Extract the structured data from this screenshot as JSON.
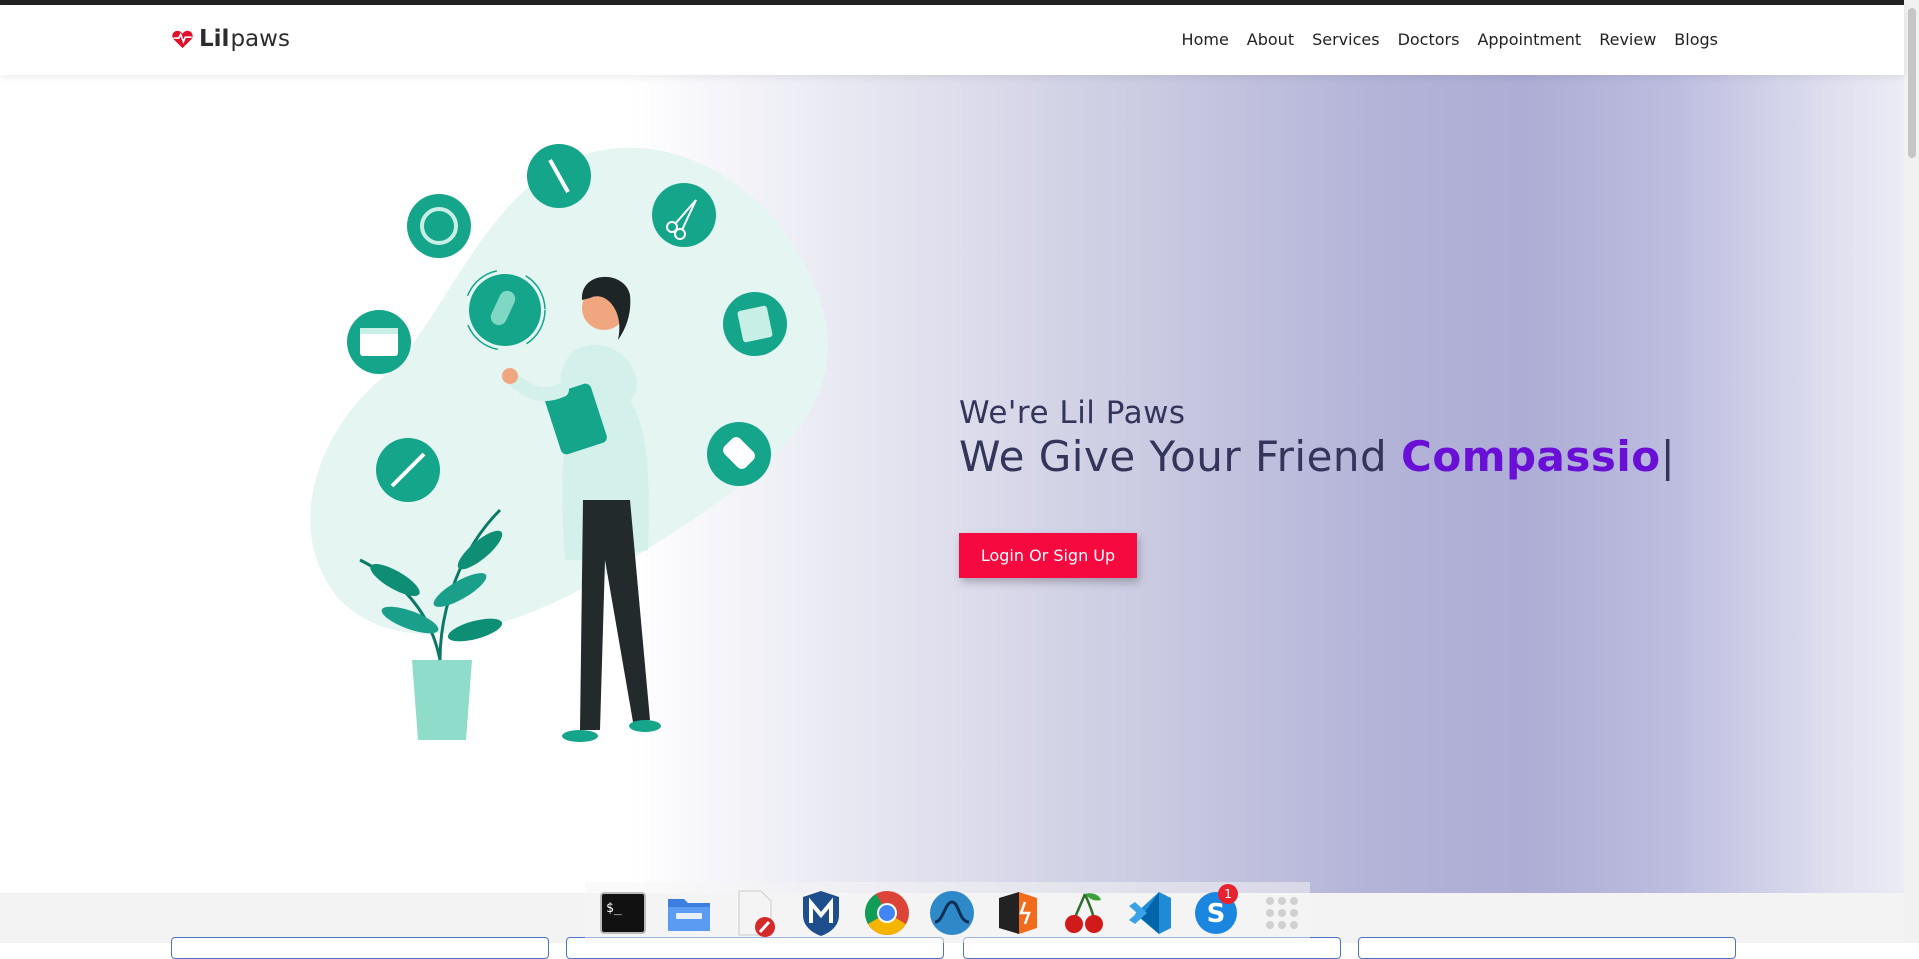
{
  "brand": {
    "bold": "Lil",
    "rest": "paws",
    "accent": "#e0112b"
  },
  "nav": {
    "items": [
      {
        "id": "home",
        "label": "Home"
      },
      {
        "id": "about",
        "label": "About"
      },
      {
        "id": "services",
        "label": "Services"
      },
      {
        "id": "doctors",
        "label": "Doctors"
      },
      {
        "id": "appointment",
        "label": "Appointment"
      },
      {
        "id": "review",
        "label": "Review"
      },
      {
        "id": "blogs",
        "label": "Blogs"
      }
    ]
  },
  "hero": {
    "subtitle": "We're Lil Paws",
    "title_prefix": "We Give Your Friend",
    "title_highlight": "Compassio",
    "cursor": "|",
    "cta_label": "Login Or Sign Up",
    "colors": {
      "highlight": "#6a0fd6",
      "cta": "#f5093f",
      "text": "#34355a"
    }
  },
  "dock": {
    "apps": [
      {
        "icon": "terminal-icon",
        "text": "$_"
      },
      {
        "icon": "file-manager-icon"
      },
      {
        "icon": "text-editor-icon"
      },
      {
        "icon": "metasploit-icon"
      },
      {
        "icon": "chrome-icon"
      },
      {
        "icon": "wireshark-icon"
      },
      {
        "icon": "burp-suite-icon"
      },
      {
        "icon": "cherrytree-icon"
      },
      {
        "icon": "vscode-icon"
      },
      {
        "icon": "skype-icon",
        "badge": "1"
      },
      {
        "icon": "app-grid-icon"
      }
    ]
  }
}
